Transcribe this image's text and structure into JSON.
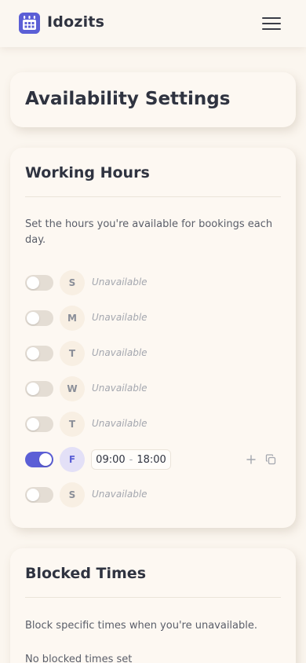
{
  "header": {
    "brand": "Idozits",
    "logo_icon": "calendar-icon",
    "menu_icon": "hamburger-menu-icon",
    "accent_color": "#5b5fd6"
  },
  "page": {
    "title": "Availability Settings"
  },
  "working_hours": {
    "title": "Working Hours",
    "description": "Set the hours you're available for bookings each day.",
    "days": [
      {
        "day": "S",
        "enabled": false,
        "status": "Unavailable"
      },
      {
        "day": "M",
        "enabled": false,
        "status": "Unavailable"
      },
      {
        "day": "T",
        "enabled": false,
        "status": "Unavailable"
      },
      {
        "day": "W",
        "enabled": false,
        "status": "Unavailable"
      },
      {
        "day": "T",
        "enabled": false,
        "status": "Unavailable"
      },
      {
        "day": "F",
        "enabled": true,
        "start": "09:00",
        "separator": "-",
        "end": "18:00",
        "actions": [
          "plus-icon",
          "copy-icon"
        ]
      },
      {
        "day": "S",
        "enabled": false,
        "status": "Unavailable"
      }
    ]
  },
  "blocked_times": {
    "title": "Blocked Times",
    "description": "Block specific times when you're unavailable.",
    "empty_text": "No blocked times set"
  }
}
